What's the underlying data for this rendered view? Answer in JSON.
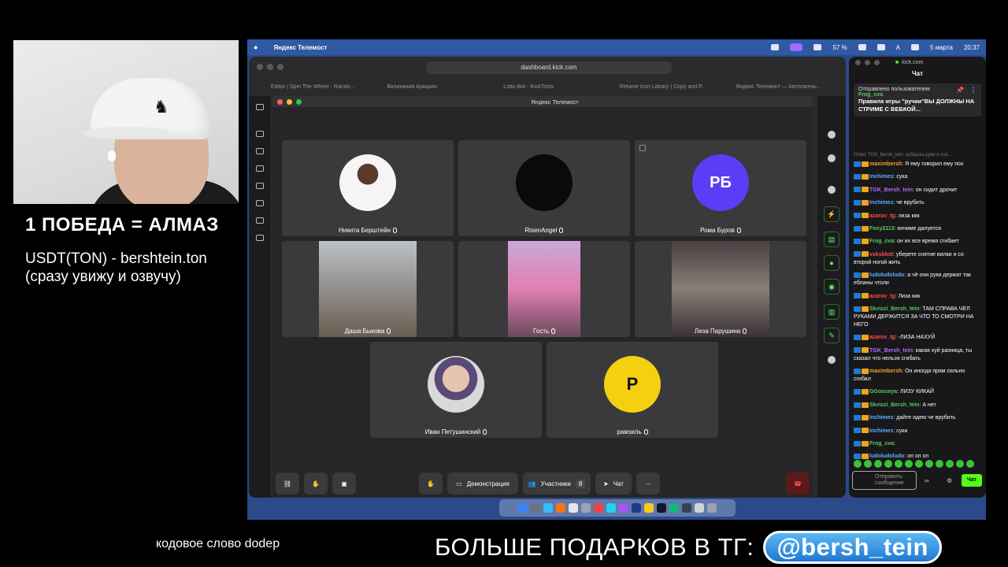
{
  "overlay": {
    "title": "1 ПОБЕДА = АЛМАЗ",
    "line1": "USDT(TON) - bershtein.ton",
    "line2": "(сразу увижу и озвучу)",
    "bottom_left": "кодовое слово dodep",
    "bottom_right": "БОЛЬШЕ ПОДАРКОВ В ТГ:",
    "tg_handle": "@bersh_tein"
  },
  "menubar": {
    "app_name": "Яндекс Телемост",
    "battery": "57 %",
    "input_lang": "A",
    "date": "5 марта",
    "time": "20:37"
  },
  "browser": {
    "url": "dashboard.kick.com",
    "tabs": [
      "Editor | Spin The Wheel - Rando...",
      "Вкликаний Аукцион",
      "Lotto Bot - KickTools",
      "Relume Icon Library | Copy and P...",
      "Яндекс Телемост — бесплатны..."
    ]
  },
  "telemost": {
    "window_title": "Яндекс Телемост",
    "participants": [
      {
        "name": "Никита Берштейн"
      },
      {
        "name": "RisenAngel"
      },
      {
        "name": "Рома Буров",
        "initials": "РБ"
      },
      {
        "name": "Даша Быкова"
      },
      {
        "name": "Гость"
      },
      {
        "name": "Лиза Парушина"
      },
      {
        "name": "Иван Петушинский"
      },
      {
        "name": "рамзиль",
        "initials": "Р"
      }
    ],
    "toolbar": {
      "demo_label": "Демонстрация",
      "participants_label": "Участники",
      "participants_count": "8",
      "chat_label": "Чат"
    }
  },
  "chat": {
    "site": "kick.com",
    "header": "Чат",
    "pinned_by": "Отправлено пользователем",
    "pinned_user": "Frog_cva",
    "pinned_text": "Правила игры \"ручки\"ВЫ ДОЛЖНЫ НА СТРИМЕ С ВЕБКОЙ...",
    "reply_preview": "Ответ TGK_Bersh_tein: рубашка руки е пох...",
    "messages": [
      {
        "user": "maximbersh",
        "text": "Я ему говорил ему пох",
        "color": "#f0a31b"
      },
      {
        "user": "Inchimes",
        "text": "сука",
        "color": "#5ab0ff"
      },
      {
        "user": "TGK_Bersh_tein",
        "text": "он сидит дрочит",
        "color": "#b26bff"
      },
      {
        "user": "Inchimes",
        "text": "че врубить",
        "color": "#5ab0ff"
      },
      {
        "user": "azarov_tg",
        "text": "лиза кик",
        "color": "#ff4d4d"
      },
      {
        "user": "Foxy2113",
        "text": "инчиме далуется",
        "color": "#5ac85a"
      },
      {
        "user": "Frog_cva",
        "text": "он их все время сгибает",
        "color": "#5ac85a"
      },
      {
        "user": "vsksbkst",
        "text": "уберете снятие вилки я со второй ногой жить",
        "color": "#ff4d4d"
      },
      {
        "user": "ludoludoludo",
        "text": "а чё они руки держат так ебланы чтоли",
        "color": "#5ab0ff"
      },
      {
        "user": "azarov_tg",
        "text": "Лиза кик",
        "color": "#ff4d4d"
      },
      {
        "user": "Skvizzi_Bersh_tein",
        "text": "ТАМ СПРАВА ЧЕЛ РУКАМИ ДЕРЖИТСЯ ЗА ЧТО ТО СМОТРИ НА НЕГО",
        "color": "#5ac85a"
      },
      {
        "user": "azarov_tg",
        "text": "-ЛИЗА НАХУЙ",
        "color": "#ff4d4d"
      },
      {
        "user": "TGK_Bersh_tein",
        "text": "какая хуй разница, ты сказал что нельзя сгибать",
        "color": "#b26bff"
      },
      {
        "user": "maximbersh",
        "text": "Он иногда прям сильно сгибал",
        "color": "#f0a31b"
      },
      {
        "user": "GGooseya",
        "text": "ЛИЗУ КИКАЙ",
        "color": "#5ac85a"
      },
      {
        "user": "Skvizzi_Bersh_tein",
        "text": "А нет",
        "color": "#5ac85a"
      },
      {
        "user": "Inchimes",
        "text": "дайте идею че врубить",
        "color": "#5ab0ff"
      },
      {
        "user": "Inchimes",
        "text": "суки",
        "color": "#5ab0ff"
      },
      {
        "user": "Frog_cva",
        "text": "",
        "color": "#5ac85a"
      },
      {
        "user": "ludoludoludo",
        "text": "оп оп оп",
        "color": "#5ab0ff"
      }
    ],
    "input_placeholder": "Отправить сообщение",
    "send_label": "Чат"
  },
  "colors": {
    "kick_green": "#53fc18",
    "desktop_blue": "#2a4a8a",
    "avatar_rb": "#5b3df5",
    "avatar_r": "#f5d010"
  }
}
